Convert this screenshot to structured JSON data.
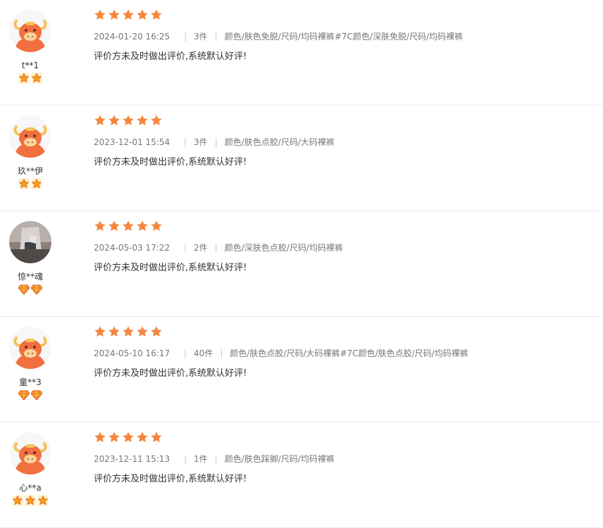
{
  "colors": {
    "star": "#f4873f",
    "avatar_bull": "#f26f3f",
    "divider": "#ececec"
  },
  "reviews": [
    {
      "nickname": "t**1",
      "avatar": "bull-avatar-icon",
      "badge_type": "star-badge-icon",
      "badge_count": 2,
      "rating": 5,
      "date": "2024-01-20 16:25",
      "quantity": "3件",
      "sku": "颜色/肤色免脱/尺码/均码裸裤#7C颜色/深肤免脱/尺码/均码裸裤",
      "text": "评价方未及时做出评价,系统默认好评!"
    },
    {
      "nickname": "玖**伊",
      "avatar": "bull-avatar-icon",
      "badge_type": "star-badge-icon",
      "badge_count": 2,
      "rating": 5,
      "date": "2023-12-01 15:54",
      "quantity": "3件",
      "sku": "颜色/肤色点胶/尺码/大码裸裤",
      "text": "评价方未及时做出评价,系统默认好评!"
    },
    {
      "nickname": "惊**魂",
      "avatar": "photo-avatar",
      "badge_type": "diamond-badge-icon",
      "badge_count": 2,
      "rating": 5,
      "date": "2024-05-03 17:22",
      "quantity": "2件",
      "sku": "颜色/深肤色点胶/尺码/均码裸裤",
      "text": "评价方未及时做出评价,系统默认好评!"
    },
    {
      "nickname": "童**3",
      "avatar": "bull-avatar-icon",
      "badge_type": "diamond-badge-icon",
      "badge_count": 2,
      "rating": 5,
      "date": "2024-05-10 16:17",
      "quantity": "40件",
      "sku": "颜色/肤色点胶/尺码/大码裸裤#7C颜色/肤色点胶/尺码/均码裸裤",
      "text": "评价方未及时做出评价,系统默认好评!"
    },
    {
      "nickname": "心**a",
      "avatar": "bull-avatar-icon",
      "badge_type": "star-badge-icon",
      "badge_count": 3,
      "rating": 5,
      "date": "2023-12-11 15:13",
      "quantity": "1件",
      "sku": "颜色/肤色踩脚/尺码/均码裸裤",
      "text": "评价方未及时做出评价,系统默认好评!"
    }
  ]
}
